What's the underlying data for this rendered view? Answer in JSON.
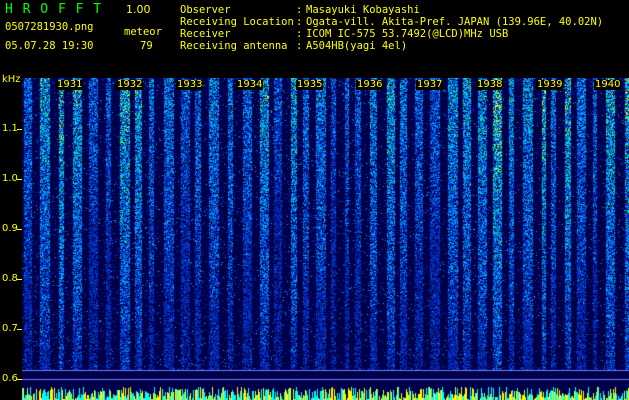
{
  "app": {
    "title": "H R O F F T",
    "version": "1.00"
  },
  "file": {
    "name": "0507281930.png",
    "datetime": "05.07.28 19:30"
  },
  "meteor": {
    "label": "meteor",
    "count": "79"
  },
  "info": [
    {
      "label": "Observer",
      "value": "Masayuki Kobayashi"
    },
    {
      "label": "Receiving Location",
      "value": "Ogata-vill. Akita-Pref. JAPAN (139.96E, 40.02N)"
    },
    {
      "label": "Receiver",
      "value": "ICOM IC-575 53.7492(@LCD)MHz USB"
    },
    {
      "label": "Receiving antenna",
      "value": "A504HB(yagi 4el)"
    }
  ],
  "spectrogram": {
    "y_unit": "kHz",
    "y_ticks": [
      "1.1",
      "1.0",
      "0.9",
      "0.8",
      "0.7",
      "0.6"
    ],
    "time_labels": [
      "1931",
      "1932",
      "1933",
      "1934",
      "1935",
      "1936",
      "1937",
      "1938",
      "1939",
      "1940"
    ],
    "colors": {
      "bg": "#00004a",
      "low": "#0033cc",
      "mid": "#00aaff",
      "high": "#00ff88",
      "peak": "#ffff00"
    }
  }
}
